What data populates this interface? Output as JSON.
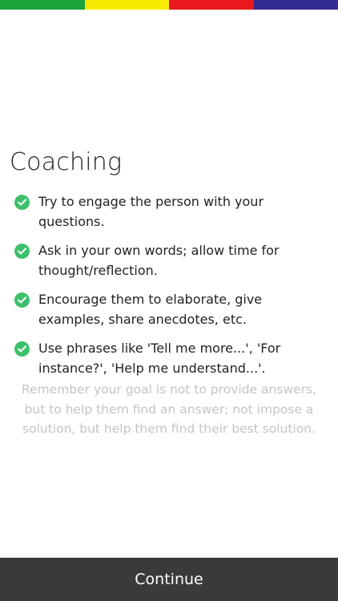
{
  "colors": {
    "strip": [
      "#1aa43c",
      "#f7ec00",
      "#e8191c",
      "#332b8f"
    ],
    "check": "#3cc16a",
    "button_bg": "#3a3a3a"
  },
  "title": "Coaching",
  "tips": [
    {
      "icon": "check-circle-icon",
      "text": "Try to engage the person with your questions."
    },
    {
      "icon": "check-circle-icon",
      "text": "Ask in your own words; allow time for thought/reflection."
    },
    {
      "icon": "check-circle-icon",
      "text": "Encourage them to elaborate, give examples, share anecdotes, etc."
    },
    {
      "icon": "check-circle-icon",
      "text": "Use phrases like 'Tell me more...', 'For instance?', 'Help me understand...'."
    }
  ],
  "note": "Remember your goal is not to provide answers, but to help them find an answer; not impose a solution, but help them find their best solution.",
  "continue_label": "Continue"
}
